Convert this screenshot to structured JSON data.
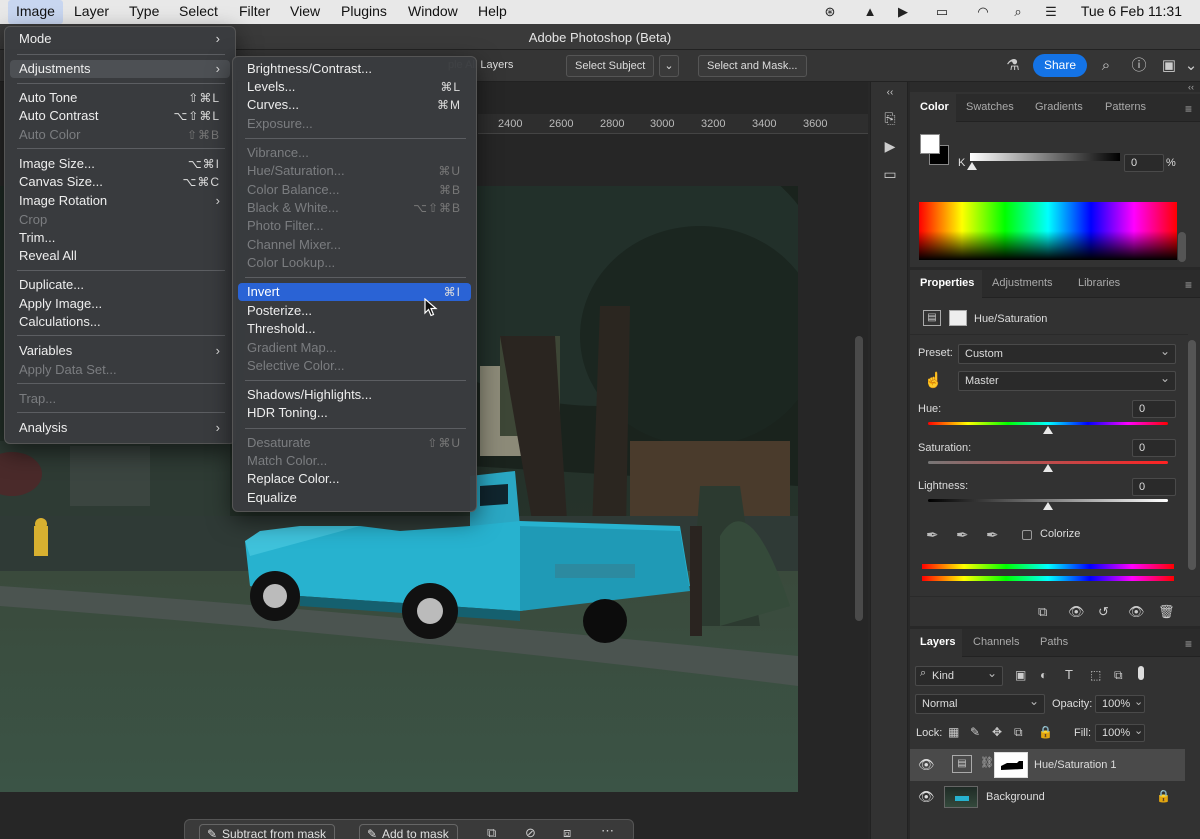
{
  "macmenu": {
    "items": [
      "Image",
      "Layer",
      "Type",
      "Select",
      "Filter",
      "View",
      "Plugins",
      "Window",
      "Help"
    ],
    "clock": "Tue 6 Feb  11:31"
  },
  "window_title": "Adobe Photoshop (Beta)",
  "options": {
    "sample_all_layers": "ple All Layers",
    "select_subject": "Select Subject",
    "select_and_mask": "Select and Mask...",
    "share": "Share"
  },
  "ruler_ticks": [
    "2400",
    "2600",
    "2800",
    "3000",
    "3200",
    "3400",
    "3600"
  ],
  "bottom_bar": {
    "subtract": "Subtract from mask",
    "add": "Add to mask"
  },
  "image_menu": [
    {
      "label": "Mode",
      "sub": true
    },
    {
      "label": "Adjustments",
      "sub": true,
      "hl": true
    },
    {
      "label": "Auto Tone",
      "shortcut": "⇧⌘L"
    },
    {
      "label": "Auto Contrast",
      "shortcut": "⌥⇧⌘L"
    },
    {
      "label": "Auto Color",
      "shortcut": "⇧⌘B",
      "dis": true
    },
    {
      "label": "Image Size...",
      "shortcut": "⌥⌘I"
    },
    {
      "label": "Canvas Size...",
      "shortcut": "⌥⌘C"
    },
    {
      "label": "Image Rotation",
      "sub": true
    },
    {
      "label": "Crop",
      "dis": true
    },
    {
      "label": "Trim..."
    },
    {
      "label": "Reveal All"
    },
    {
      "label": "Duplicate..."
    },
    {
      "label": "Apply Image..."
    },
    {
      "label": "Calculations..."
    },
    {
      "label": "Variables",
      "sub": true
    },
    {
      "label": "Apply Data Set...",
      "dis": true
    },
    {
      "label": "Trap...",
      "dis": true
    },
    {
      "label": "Analysis",
      "sub": true
    }
  ],
  "adjust_menu": [
    {
      "label": "Brightness/Contrast..."
    },
    {
      "label": "Levels...",
      "shortcut": "⌘L"
    },
    {
      "label": "Curves...",
      "shortcut": "⌘M"
    },
    {
      "label": "Exposure...",
      "dis": true
    },
    {
      "label": "Vibrance...",
      "dis": true
    },
    {
      "label": "Hue/Saturation...",
      "shortcut": "⌘U",
      "dis": true
    },
    {
      "label": "Color Balance...",
      "shortcut": "⌘B",
      "dis": true
    },
    {
      "label": "Black & White...",
      "shortcut": "⌥⇧⌘B",
      "dis": true
    },
    {
      "label": "Photo Filter...",
      "dis": true
    },
    {
      "label": "Channel Mixer...",
      "dis": true
    },
    {
      "label": "Color Lookup...",
      "dis": true
    },
    {
      "label": "Invert",
      "shortcut": "⌘I",
      "hl": true
    },
    {
      "label": "Posterize..."
    },
    {
      "label": "Threshold..."
    },
    {
      "label": "Gradient Map...",
      "dis": true
    },
    {
      "label": "Selective Color...",
      "dis": true
    },
    {
      "label": "Shadows/Highlights..."
    },
    {
      "label": "HDR Toning..."
    },
    {
      "label": "Desaturate",
      "shortcut": "⇧⌘U",
      "dis": true
    },
    {
      "label": "Match Color...",
      "dis": true
    },
    {
      "label": "Replace Color..."
    },
    {
      "label": "Equalize"
    }
  ],
  "color_panel": {
    "tabs": [
      "Color",
      "Swatches",
      "Gradients",
      "Patterns"
    ],
    "k_label": "K",
    "k_value": "0",
    "k_unit": "%"
  },
  "properties_panel": {
    "tabs": [
      "Properties",
      "Adjustments",
      "Libraries"
    ],
    "adjustment_name": "Hue/Saturation",
    "preset_label": "Preset:",
    "preset_value": "Custom",
    "channel_value": "Master",
    "hue_label": "Hue:",
    "hue_value": "0",
    "saturation_label": "Saturation:",
    "saturation_value": "0",
    "lightness_label": "Lightness:",
    "lightness_value": "0",
    "colorize_label": "Colorize"
  },
  "layers_panel": {
    "tabs": [
      "Layers",
      "Channels",
      "Paths"
    ],
    "filter_kind": "Kind",
    "blend_mode": "Normal",
    "opacity_label": "Opacity:",
    "opacity_value": "100%",
    "lock_label": "Lock:",
    "fill_label": "Fill:",
    "fill_value": "100%",
    "layers": [
      {
        "name": "Hue/Saturation 1"
      },
      {
        "name": "Background"
      }
    ]
  }
}
